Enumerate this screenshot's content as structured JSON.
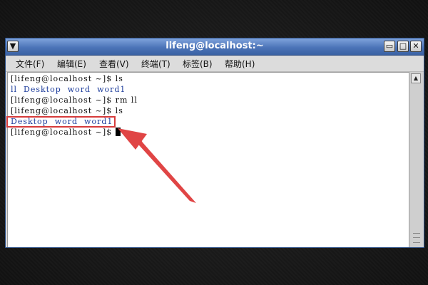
{
  "window": {
    "title": "lifeng@localhost:~",
    "controls": {
      "minimize": "▭",
      "maximize": "□",
      "close": "✕"
    }
  },
  "menu": [
    {
      "label": "文件(F)"
    },
    {
      "label": "编辑(E)"
    },
    {
      "label": "查看(V)"
    },
    {
      "label": "终端(T)"
    },
    {
      "label": "标签(B)"
    },
    {
      "label": "帮助(H)"
    }
  ],
  "terminal": {
    "line1": "[lifeng@localhost ~]$ ls",
    "line2": "ll  Desktop  word  word1",
    "line3": "[lifeng@localhost ~]$ rm ll",
    "line4": "[lifeng@localhost ~]$ ls",
    "line5": "Desktop  word  word1",
    "line6": "[lifeng@localhost ~]$ "
  },
  "scrollbar": {
    "up_glyph": "▲"
  },
  "annotation": {
    "box_color": "#d63b3b",
    "arrow_color": "#e04545"
  }
}
